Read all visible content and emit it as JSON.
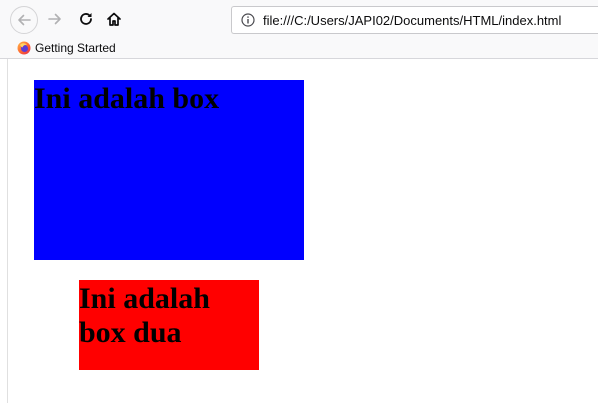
{
  "toolbar": {
    "back_icon": "arrow-left-icon",
    "forward_icon": "arrow-right-icon",
    "reload_icon": "reload-icon",
    "home_icon": "home-icon",
    "url": "file:///C:/Users/JAPI02/Documents/HTML/index.html",
    "info_icon": "info-icon"
  },
  "bookmarks": {
    "items": [
      {
        "label": "Getting Started",
        "icon": "firefox-icon"
      }
    ]
  },
  "page": {
    "box1_text": "Ini adalah box",
    "box1_color": "#0000ff",
    "box2_text": "Ini adalah box dua",
    "box2_color": "#ff0000"
  }
}
